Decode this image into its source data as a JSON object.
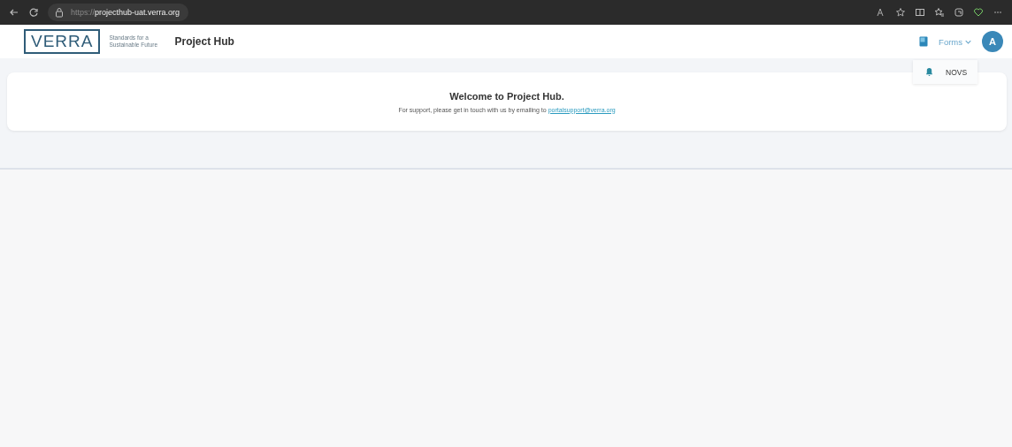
{
  "browser": {
    "url_scheme": "https://",
    "url_host": "projecthub-uat.verra.org"
  },
  "header": {
    "logo": "VERRA",
    "tagline": "Standards for a Sustainable Future",
    "app_title": "Project Hub",
    "forms_menu": {
      "label": "Forms",
      "expanded": true,
      "items": [
        {
          "label": "NOVS"
        }
      ]
    },
    "avatar": "A"
  },
  "welcome": {
    "title": "Welcome to Project Hub.",
    "text": "For support, please get in touch with us by emailing to ",
    "email": "portalsupport@verra.org"
  }
}
